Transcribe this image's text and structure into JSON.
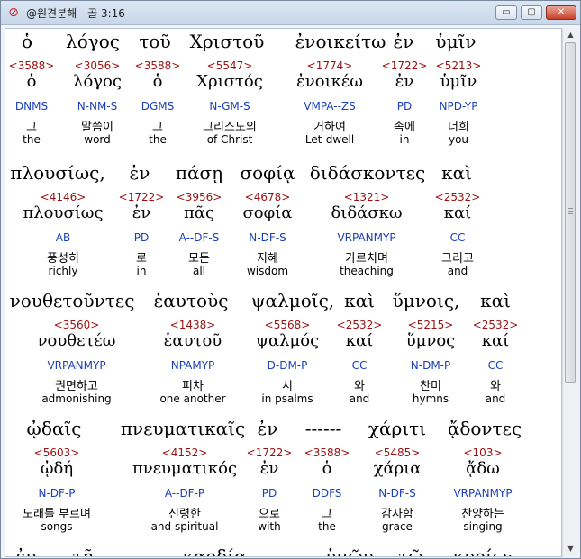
{
  "window": {
    "title": "@원견분해 - 골 3:16",
    "icon": "app-icon",
    "controls": {
      "minimize": "▭",
      "maximize": "▢",
      "close": "✕"
    }
  },
  "blocks": [
    {
      "greek_line": [
        {
          "text": "ὁ"
        },
        {
          "text": "λόγος"
        },
        {
          "text": "τοῦ"
        },
        {
          "text": "Χριστοῦ"
        },
        {
          "text": "ἐνοικείτω"
        },
        {
          "text": "ἐν"
        },
        {
          "text": "ὑμῖν"
        }
      ],
      "words": [
        {
          "strong": "<3588>",
          "lemma": "ὁ",
          "parse": "DNMS",
          "kor": "그",
          "eng": "the"
        },
        {
          "strong": "<3056>",
          "lemma": "λόγος",
          "parse": "N-NM-S",
          "kor": "말씀이",
          "eng": "word"
        },
        {
          "strong": "<3588>",
          "lemma": "ὁ",
          "parse": "DGMS",
          "kor": "그",
          "eng": "the"
        },
        {
          "strong": "<5547>",
          "lemma": "Χριστός",
          "parse": "N-GM-S",
          "kor": "그리스도의",
          "eng": "of Christ"
        },
        {
          "strong": "<1774>",
          "lemma": "ἐνοικέω",
          "parse": "VMPA--ZS",
          "kor": "거하여",
          "eng": "Let-dwell"
        },
        {
          "strong": "<1722>",
          "lemma": "ἐν",
          "parse": "PD",
          "kor": "속에",
          "eng": "in"
        },
        {
          "strong": "<5213>",
          "lemma": "ὑμῖν",
          "parse": "NPD-YP",
          "kor": "너희",
          "eng": "you"
        }
      ]
    },
    {
      "greek_line": [
        {
          "text": "πλουσίως,"
        },
        {
          "text": "ἐν"
        },
        {
          "text": "πάσῃ"
        },
        {
          "text": "σοφίᾳ"
        },
        {
          "text": "διδάσκοντες"
        },
        {
          "text": "καὶ"
        }
      ],
      "words": [
        {
          "strong": "<4146>",
          "lemma": "πλουσίως",
          "parse": "AB",
          "kor": "풍성히",
          "eng": "richly"
        },
        {
          "strong": "<1722>",
          "lemma": "ἐν",
          "parse": "PD",
          "kor": "로",
          "eng": "in"
        },
        {
          "strong": "<3956>",
          "lemma": "πᾶς",
          "parse": "A--DF-S",
          "kor": "모든",
          "eng": "all"
        },
        {
          "strong": "<4678>",
          "lemma": "σοφία",
          "parse": "N-DF-S",
          "kor": "지혜",
          "eng": "wisdom"
        },
        {
          "strong": "<1321>",
          "lemma": "διδάσκω",
          "parse": "VRPANMYP",
          "kor": "가르치며",
          "eng": "theaching"
        },
        {
          "strong": "<2532>",
          "lemma": "καί",
          "parse": "CC",
          "kor": "그리고",
          "eng": "and"
        }
      ]
    },
    {
      "greek_line": [
        {
          "text": "νουθετοῦντες"
        },
        {
          "text": "ἑαυτοὺς"
        },
        {
          "text": "ψαλμοῖς,"
        },
        {
          "text": "καὶ"
        },
        {
          "text": "ὕμνοις,"
        },
        {
          "text": "καὶ"
        }
      ],
      "words": [
        {
          "strong": "<3560>",
          "lemma": "νουθετέω",
          "parse": "VRPANMYP",
          "kor": "권면하고",
          "eng": "admonishing"
        },
        {
          "strong": "<1438>",
          "lemma": "ἑαυτοῦ",
          "parse": "NPAMYP",
          "kor": "피차",
          "eng": "one another"
        },
        {
          "strong": "<5568>",
          "lemma": "ψαλμός",
          "parse": "D-DM-P",
          "kor": "시",
          "eng": "in psalms"
        },
        {
          "strong": "<2532>",
          "lemma": "καί",
          "parse": "CC",
          "kor": "와",
          "eng": "and"
        },
        {
          "strong": "<5215>",
          "lemma": "ὕμνος",
          "parse": "N-DM-P",
          "kor": "찬미",
          "eng": "hymns"
        },
        {
          "strong": "<2532>",
          "lemma": "καί",
          "parse": "CC",
          "kor": "와",
          "eng": "and"
        }
      ]
    },
    {
      "greek_line": [
        {
          "text": "ᾠδαῖς"
        },
        {
          "text": "πνευματικαῖς"
        },
        {
          "text": "ἐν"
        },
        {
          "text": "------"
        },
        {
          "text": "χάριτι"
        },
        {
          "text": "ᾄδοντες"
        }
      ],
      "words": [
        {
          "strong": "<5603>",
          "lemma": "ᾠδή",
          "parse": "N-DF-P",
          "kor": "노래를 부르며",
          "eng": "songs"
        },
        {
          "strong": "<4152>",
          "lemma": "πνευματικός",
          "parse": "A--DF-P",
          "kor": "신령한",
          "eng": "and spiritual"
        },
        {
          "strong": "<1722>",
          "lemma": "ἐν",
          "parse": "PD",
          "kor": "으로",
          "eng": "with"
        },
        {
          "strong": "<3588>",
          "lemma": "ὁ",
          "parse": "DDFS",
          "kor": "그",
          "eng": "the"
        },
        {
          "strong": "<5485>",
          "lemma": "χάρια",
          "parse": "N-DF-S",
          "kor": "감사함",
          "eng": "grace"
        },
        {
          "strong": "<103>",
          "lemma": "ᾄδω",
          "parse": "VRPANMYP",
          "kor": "찬양하는",
          "eng": "singing"
        }
      ]
    },
    {
      "greek_line": [
        {
          "text": "ἐν"
        },
        {
          "text": "τῇ"
        },
        {
          "text": "------"
        },
        {
          "text": "καρδίᾳ"
        },
        {
          "text": "-----"
        },
        {
          "text": "ὑμῶν"
        },
        {
          "text": "τῷ"
        },
        {
          "text": "κυρίῳ·"
        }
      ],
      "words": []
    }
  ]
}
